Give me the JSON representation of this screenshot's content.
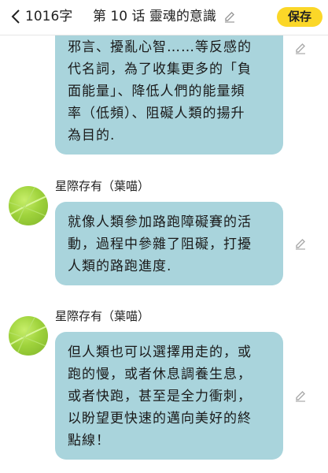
{
  "header": {
    "word_count": "1016字",
    "chapter_title": "第 10 话 靈魂的意識",
    "save_label": "保存"
  },
  "messages": [
    {
      "lines": [
        "邪言、擾亂心智……等反感的",
        "代名詞，為了收集更多的「負",
        "面能量」、降低人們的能量頻",
        "率（低頻）、阻礙人類的揚升",
        "為目的."
      ]
    },
    {
      "author": "星際存有（葉喵）",
      "lines": [
        "就像人類參加路跑障礙賽的活",
        "動，過程中參雜了阻礙，打擾",
        "人類的路跑進度."
      ]
    },
    {
      "author": "星際存有（葉喵）",
      "lines": [
        "但人類也可以選擇用走的，或",
        "跑的慢，或者休息調養生息，",
        "或者快跑，甚至是全力衝刺，",
        "以盼望更快速的邁向美好的終",
        "點線！"
      ]
    }
  ],
  "icons": {
    "back": "chevron-left-icon",
    "edit": "pencil-icon",
    "avatar": "green-leaf-avatar"
  },
  "colors": {
    "bubble": "#a9d4dc",
    "save_button": "#fbd728",
    "avatar": "#9fd33c"
  }
}
